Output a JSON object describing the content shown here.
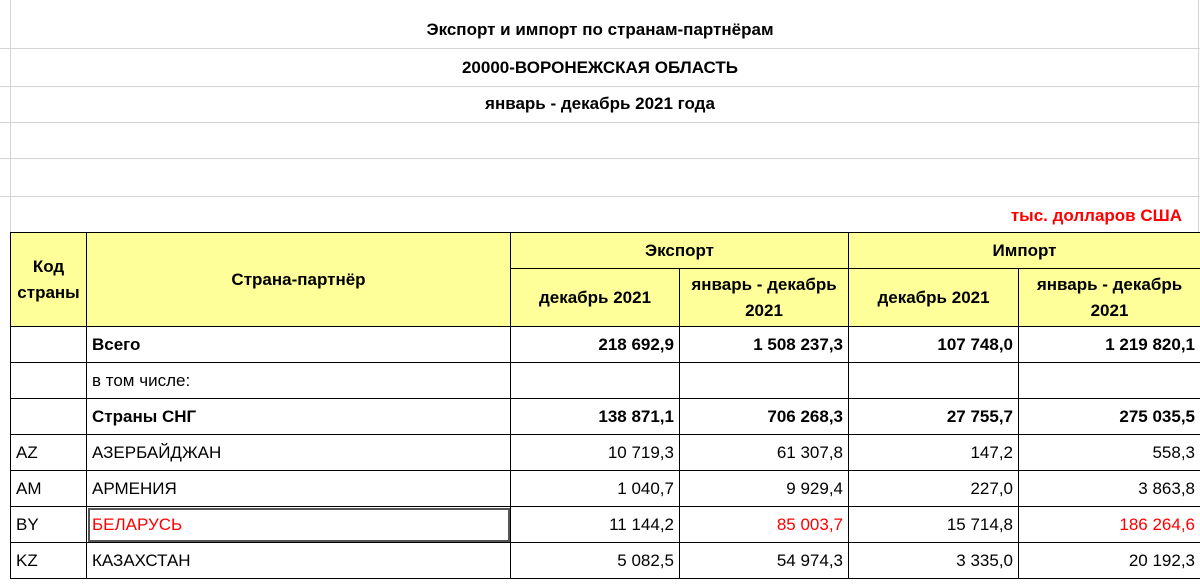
{
  "titles": {
    "line1": "Экспорт и импорт по странам-партнёрам",
    "line2": "20000-ВОРОНЕЖСКАЯ ОБЛАСТЬ",
    "line3": "январь - декабрь 2021 года"
  },
  "units": "тыс. долларов США",
  "colors": {
    "header_bg": "#ffff99",
    "highlight_text": "#ff0000"
  },
  "table": {
    "headers": {
      "code": "Код страны",
      "country": "Страна-партнёр",
      "export": "Экспорт",
      "import": "Импорт",
      "export_dec": "декабрь 2021",
      "export_ytd": "январь - декабрь 2021",
      "import_dec": "декабрь 2021",
      "import_ytd": "январь - декабрь 2021"
    },
    "rows": [
      {
        "code": "",
        "country": "Всего",
        "exp_dec": "218 692,9",
        "exp_ytd": "1 508 237,3",
        "imp_dec": "107 748,0",
        "imp_ytd": "1 219 820,1"
      },
      {
        "code": "",
        "country": "в том числе:",
        "exp_dec": "",
        "exp_ytd": "",
        "imp_dec": "",
        "imp_ytd": ""
      },
      {
        "code": "",
        "country": "Страны СНГ",
        "exp_dec": "138 871,1",
        "exp_ytd": "706 268,3",
        "imp_dec": "27 755,7",
        "imp_ytd": "275 035,5"
      },
      {
        "code": "AZ",
        "country": "АЗЕРБАЙДЖАН",
        "exp_dec": "10 719,3",
        "exp_ytd": "61 307,8",
        "imp_dec": "147,2",
        "imp_ytd": "558,3"
      },
      {
        "code": "AM",
        "country": "АРМЕНИЯ",
        "exp_dec": "1 040,7",
        "exp_ytd": "9 929,4",
        "imp_dec": "227,0",
        "imp_ytd": "3 863,8"
      },
      {
        "code": "BY",
        "country": "БЕЛАРУСЬ",
        "exp_dec": "11 144,2",
        "exp_ytd": "85 003,7",
        "imp_dec": "15 714,8",
        "imp_ytd": "186 264,6"
      },
      {
        "code": "KZ",
        "country": "КАЗАХСТАН",
        "exp_dec": "5 082,5",
        "exp_ytd": "54 974,3",
        "imp_dec": "3 335,0",
        "imp_ytd": "20 192,3"
      }
    ]
  }
}
